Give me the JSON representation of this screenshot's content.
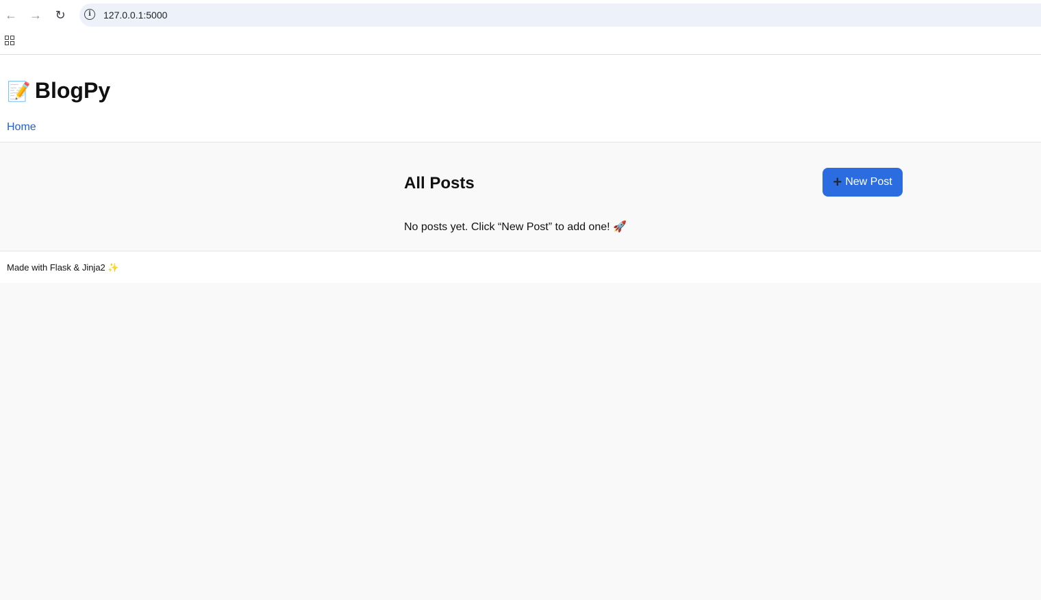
{
  "browser": {
    "url": "127.0.0.1:5000",
    "back_glyph": "←",
    "forward_glyph": "→",
    "reload_glyph": "↻",
    "info_glyph": "i"
  },
  "site": {
    "emoji": "📝",
    "title": "BlogPy",
    "nav": {
      "home_label": "Home"
    }
  },
  "main": {
    "heading": "All Posts",
    "new_post_label": "New Post",
    "plus_glyph": "+",
    "empty_message": "No posts yet. Click “New Post” to add one! 🚀"
  },
  "footer": {
    "text": "Made with Flask & Jinja2 ✨"
  },
  "colors": {
    "accent": "#2b6de1",
    "link": "#1f5fd1",
    "page_bg": "#f9f9f9"
  }
}
